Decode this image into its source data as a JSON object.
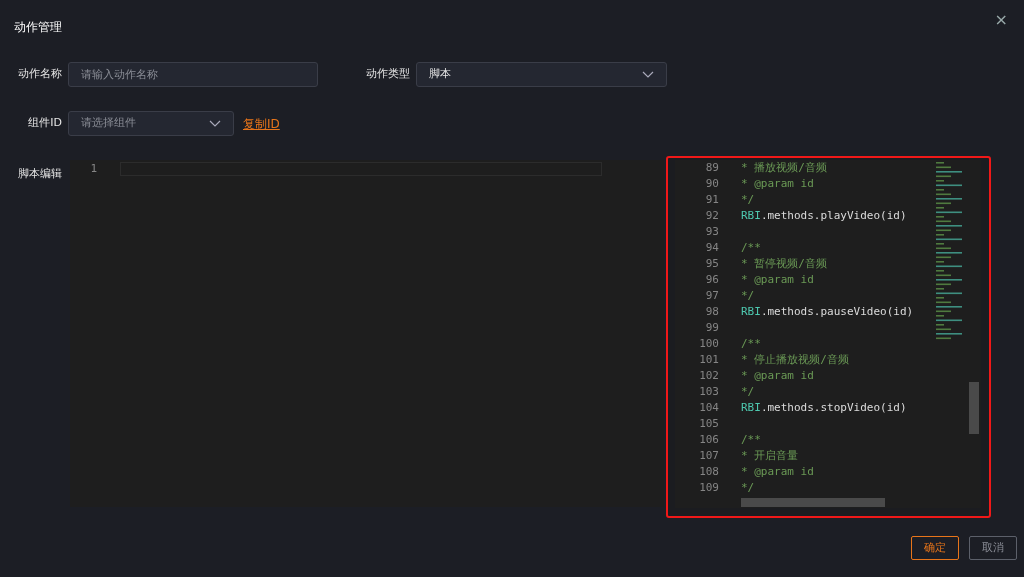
{
  "dialog": {
    "title": "动作管理",
    "close": "×"
  },
  "form": {
    "name_label": "动作名称",
    "name_placeholder": "请输入动作名称",
    "type_label": "动作类型",
    "type_value": "脚本",
    "component_label": "组件ID",
    "component_placeholder": "请选择组件",
    "copy_link": "复制ID",
    "script_label": "脚本编辑"
  },
  "editor": {
    "lines": [
      {
        "num": "1"
      }
    ]
  },
  "preview": {
    "highlighted": true,
    "lines": [
      {
        "num": "89",
        "kind": "comment",
        "text": "* 播放视频/音频"
      },
      {
        "num": "90",
        "kind": "comment",
        "text": "* @param id"
      },
      {
        "num": "91",
        "kind": "comment",
        "text": "*/"
      },
      {
        "num": "92",
        "kind": "code",
        "object": "RBI",
        "rest": ".methods.playVideo(id)"
      },
      {
        "num": "93",
        "kind": "blank"
      },
      {
        "num": "94",
        "kind": "comment",
        "text": "/**"
      },
      {
        "num": "95",
        "kind": "comment",
        "text": "* 暂停视频/音频"
      },
      {
        "num": "96",
        "kind": "comment",
        "text": "* @param id"
      },
      {
        "num": "97",
        "kind": "comment",
        "text": "*/"
      },
      {
        "num": "98",
        "kind": "code",
        "object": "RBI",
        "rest": ".methods.pauseVideo(id)"
      },
      {
        "num": "99",
        "kind": "blank"
      },
      {
        "num": "100",
        "kind": "comment",
        "text": "/**"
      },
      {
        "num": "101",
        "kind": "comment",
        "text": "* 停止播放视频/音频"
      },
      {
        "num": "102",
        "kind": "comment",
        "text": "* @param id"
      },
      {
        "num": "103",
        "kind": "comment",
        "text": "*/"
      },
      {
        "num": "104",
        "kind": "code",
        "object": "RBI",
        "rest": ".methods.stopVideo(id)"
      },
      {
        "num": "105",
        "kind": "blank"
      },
      {
        "num": "106",
        "kind": "comment",
        "text": "/**"
      },
      {
        "num": "107",
        "kind": "comment",
        "text": "* 开启音量"
      },
      {
        "num": "108",
        "kind": "comment",
        "text": "* @param id"
      },
      {
        "num": "109",
        "kind": "comment",
        "text": "*/"
      }
    ]
  },
  "buttons": [
    {
      "label": "确定",
      "kind": "primary"
    },
    {
      "label": "取消",
      "kind": "secondary"
    }
  ]
}
